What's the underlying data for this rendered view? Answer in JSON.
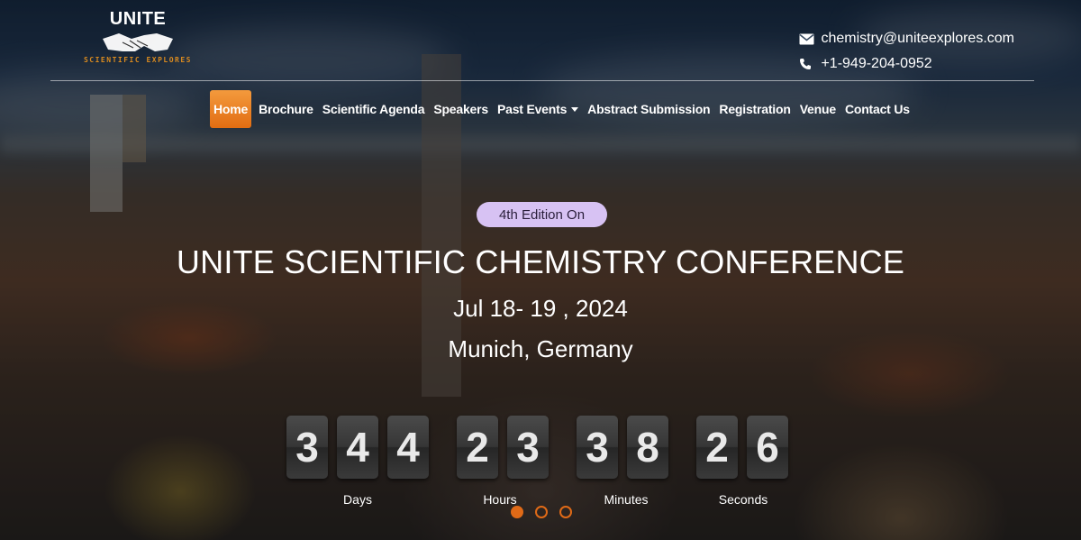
{
  "logo": {
    "word": "UNITE",
    "tagline": "SCIENTIFIC EXPLORES"
  },
  "contact": {
    "email": "chemistry@uniteexplores.com",
    "phone": "+1-949-204-0952",
    "email_icon": "envelope-icon",
    "phone_icon": "phone-icon"
  },
  "nav": {
    "items": [
      {
        "label": "Home",
        "active": true
      },
      {
        "label": "Brochure"
      },
      {
        "label": "Scientific Agenda"
      },
      {
        "label": "Speakers"
      },
      {
        "label": "Past Events",
        "dropdown": true
      },
      {
        "label": "Abstract Submission"
      },
      {
        "label": "Registration"
      },
      {
        "label": "Venue"
      },
      {
        "label": "Contact Us"
      }
    ]
  },
  "hero": {
    "badge": "4th Edition On",
    "title": "UNITE SCIENTIFIC CHEMISTRY CONFERENCE",
    "date": "Jul 18- 19 , 2024",
    "location": "Munich, Germany"
  },
  "countdown": {
    "days": [
      "3",
      "4",
      "4"
    ],
    "hours": [
      "2",
      "3"
    ],
    "minutes": [
      "3",
      "8"
    ],
    "seconds": [
      "2",
      "6"
    ],
    "labels": {
      "days": "Days",
      "hours": "Hours",
      "minutes": "Minutes",
      "seconds": "Seconds"
    }
  },
  "colors": {
    "accent": "#e8781f",
    "badge_bg": "#d7c2f3",
    "digit_bg": "#333333"
  }
}
